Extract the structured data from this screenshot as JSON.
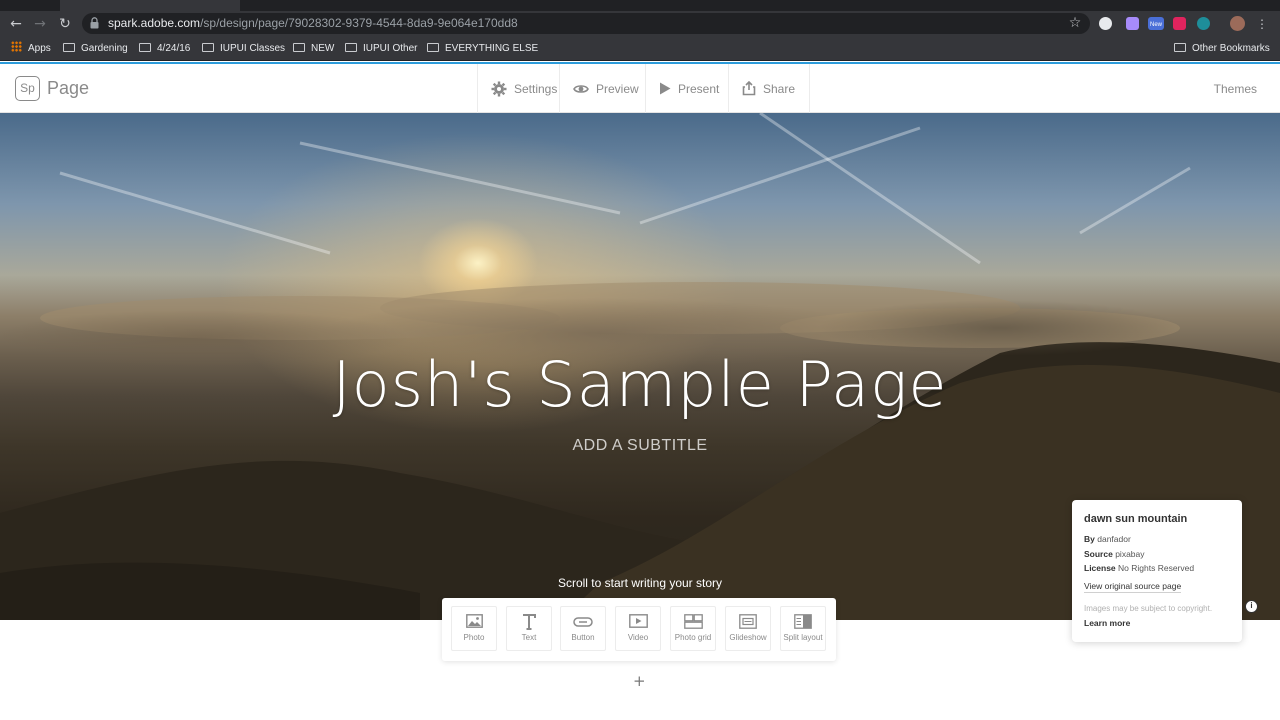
{
  "browser": {
    "url_host": "spark.adobe.com",
    "url_path": "/sp/design/page/79028302-9379-4544-8da9-9e064e170dd8",
    "bookmarks": [
      "Apps",
      "Gardening",
      "4/24/16",
      "IUPUI Classes",
      "NEW",
      "IUPUI Other",
      "EVERYTHING ELSE"
    ],
    "other_bookmarks": "Other Bookmarks",
    "extension_badge": "New"
  },
  "header": {
    "logo_mark": "Sp",
    "logo_text": "Page",
    "tools": [
      {
        "label": "Settings",
        "icon": "gear-icon"
      },
      {
        "label": "Preview",
        "icon": "eye-icon"
      },
      {
        "label": "Present",
        "icon": "play-icon"
      },
      {
        "label": "Share",
        "icon": "share-icon"
      }
    ],
    "themes": "Themes"
  },
  "hero": {
    "title": "Josh's Sample Page",
    "subtitle": "ADD A SUBTITLE",
    "scroll_hint": "Scroll to start writing your story"
  },
  "credit": {
    "title": "dawn sun mountain",
    "by_label": "By",
    "by": "danfador",
    "source_label": "Source",
    "source": "pixabay",
    "license_label": "License",
    "license": "No Rights Reserved",
    "view_link": "View original source page",
    "note": "Images may be subject to copyright.",
    "learn_more": "Learn more"
  },
  "inserter": {
    "items": [
      "Photo",
      "Text",
      "Button",
      "Video",
      "Photo grid",
      "Glideshow",
      "Split layout"
    ]
  },
  "colors": {
    "accent": "#2d9cdb",
    "chrome": "#35363a",
    "muted_text": "#8a8a8a"
  }
}
